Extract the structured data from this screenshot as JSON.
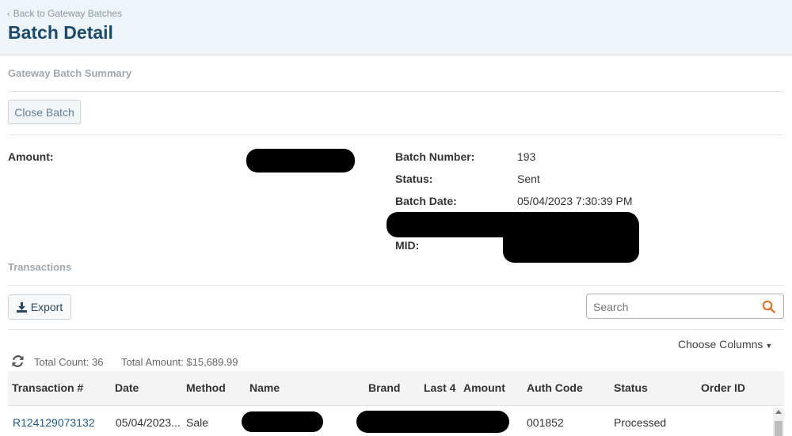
{
  "header": {
    "back_label": "Back to Gateway Batches",
    "title": "Batch Detail",
    "background": "#eef4f8",
    "title_color": "#1a4a6e"
  },
  "summary": {
    "section_title": "Gateway Batch Summary",
    "close_batch_label": "Close Batch",
    "amount_label": "Amount:",
    "batch_number_label": "Batch Number:",
    "batch_number": "193",
    "status_label": "Status:",
    "status": "Sent",
    "batch_date_label": "Batch Date:",
    "batch_date": "05/04/2023 7:30:39 PM",
    "mid_label": "MID:"
  },
  "transactions": {
    "section_title": "Transactions",
    "export_label": "Export",
    "search_placeholder": "Search",
    "search_icon_color": "#e8732a",
    "choose_columns_label": "Choose Columns",
    "total_count": "Total Count: 36",
    "total_amount": "Total Amount: $15,689.99",
    "columns": [
      "Transaction #",
      "Date",
      "Method",
      "Name",
      "Brand",
      "Last 4",
      "Amount",
      "Auth Code",
      "Status",
      "Order ID"
    ],
    "rows": [
      {
        "transaction_no": "R124129073132",
        "date": "05/04/2023...",
        "method": "Sale",
        "auth_code": "001852",
        "status": "Processed"
      }
    ]
  }
}
